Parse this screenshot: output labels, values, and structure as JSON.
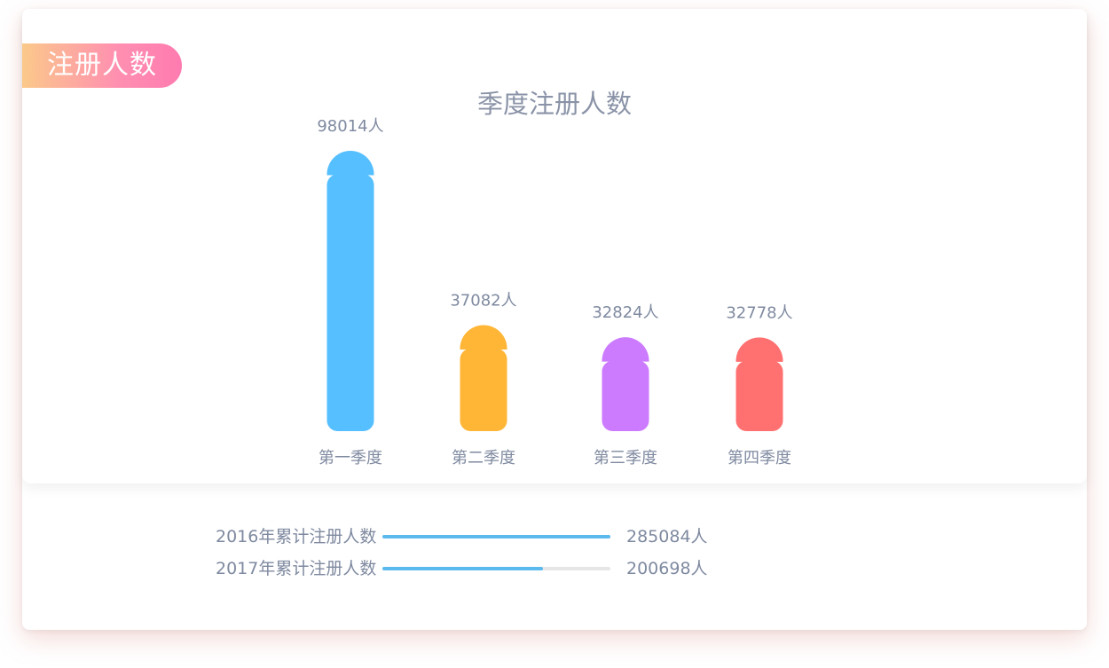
{
  "header": {
    "tag_label": "注册人数"
  },
  "chart_data": {
    "type": "bar",
    "title": "季度注册人数",
    "categories": [
      "第一季度",
      "第二季度",
      "第三季度",
      "第四季度"
    ],
    "values": [
      98014,
      37082,
      32824,
      32778
    ],
    "data_labels": [
      "98014人",
      "37082人",
      "32824人",
      "32778人"
    ],
    "colors": [
      "#55bfff",
      "#ffb536",
      "#cc7bff",
      "#ff7070"
    ],
    "ylim": [
      0,
      98014
    ],
    "grid": false,
    "xlabel": "",
    "ylabel": ""
  },
  "summary": [
    {
      "label": "2016年累计注册人数",
      "value": 285084,
      "value_text": "285084人"
    },
    {
      "label": "2017年累计注册人数",
      "value": 200698,
      "value_text": "200698人"
    }
  ],
  "colors": {
    "accent": "#5bb9ee",
    "track": "#e6e6e6",
    "text": "#7f8aa0"
  }
}
